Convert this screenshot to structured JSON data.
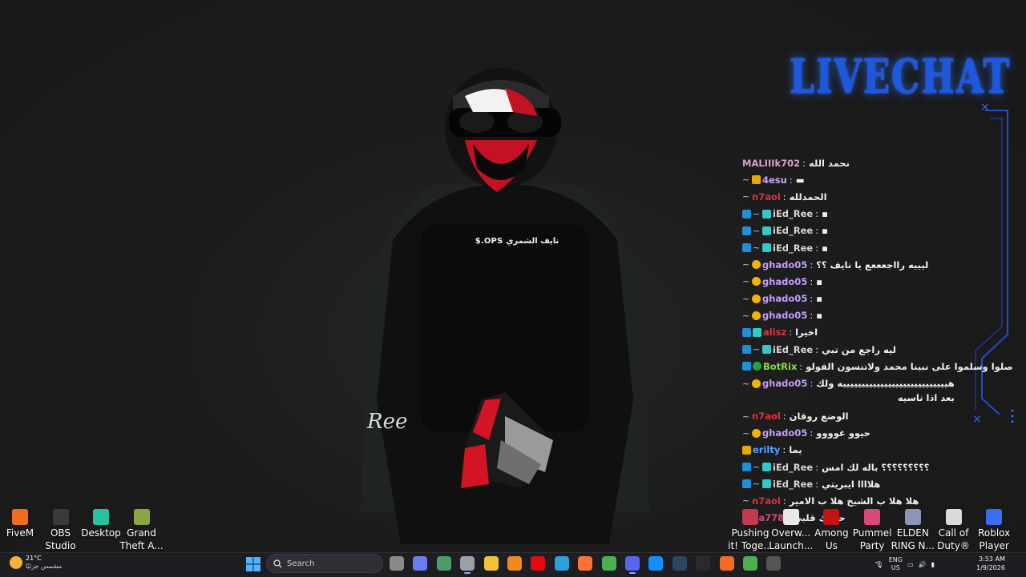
{
  "desktop": {
    "stream_overlay_name": "$.OPS نايف الشمري",
    "signature": "Ree",
    "icons_left": [
      {
        "label": "FiveM",
        "icon": "fivem-icon",
        "color": "#f26b21"
      },
      {
        "label": "OBS Studio",
        "icon": "obs-icon",
        "color": "#3a3a3a"
      },
      {
        "label": "Desktop",
        "icon": "desktop-app-icon",
        "color": "#25c2a0"
      },
      {
        "label": "Grand Theft A...",
        "icon": "gta-icon",
        "color": "#8aa640"
      }
    ],
    "icons_right": [
      {
        "label": "Pushing it! Toge...",
        "icon": "pushing-it-icon",
        "color": "#c23b4b"
      },
      {
        "label": "Overw... Launch...",
        "icon": "overwatch-icon",
        "color": "#e8e8e8"
      },
      {
        "label": "Among Us",
        "icon": "among-us-icon",
        "color": "#c51111"
      },
      {
        "label": "Pummel Party",
        "icon": "pummel-party-icon",
        "color": "#d94a7a"
      },
      {
        "label": "ELDEN RING N...",
        "icon": "elden-ring-icon",
        "color": "#8a95b8"
      },
      {
        "label": "Call of Duty®",
        "icon": "call-of-duty-icon",
        "color": "#dadada"
      },
      {
        "label": "Roblox Player",
        "icon": "roblox-icon",
        "color": "#3a6df0"
      }
    ]
  },
  "livechat": {
    "title": "LIVECHAT",
    "accent": "#1e57e0",
    "messages": [
      {
        "user": "MALIIIk702",
        "color": "#d4a3c8",
        "badges": [],
        "text": "نحمد الله"
      },
      {
        "user": "4esu",
        "color": "#c9a3ff",
        "badges": [
          "tilde",
          "gold"
        ],
        "text": "▬"
      },
      {
        "user": "n7aol",
        "color": "#e0313b",
        "badges": [
          "tilde"
        ],
        "text": "الحمدلله"
      },
      {
        "user": "iEd_Ree",
        "color": "#d6d6d6",
        "badges": [
          "prime",
          "tilde",
          "vip"
        ],
        "text": "▪"
      },
      {
        "user": "iEd_Ree",
        "color": "#d6d6d6",
        "badges": [
          "prime",
          "tilde",
          "vip"
        ],
        "text": "▪"
      },
      {
        "user": "iEd_Ree",
        "color": "#d6d6d6",
        "badges": [
          "prime",
          "tilde",
          "vip"
        ],
        "text": "▪"
      },
      {
        "user": "ghado05",
        "color": "#c69cff",
        "badges": [
          "tilde",
          "sub"
        ],
        "text": "ليييه رااجعععع يا نايف ؟؟"
      },
      {
        "user": "ghado05",
        "color": "#c69cff",
        "badges": [
          "tilde",
          "sub"
        ],
        "text": "▪"
      },
      {
        "user": "ghado05",
        "color": "#c69cff",
        "badges": [
          "tilde",
          "sub"
        ],
        "text": "▪"
      },
      {
        "user": "ghado05",
        "color": "#c69cff",
        "badges": [
          "tilde",
          "sub"
        ],
        "text": "▪"
      },
      {
        "user": "alisz",
        "color": "#e0313b",
        "badges": [
          "prime",
          "vip"
        ],
        "text": "اخيرا"
      },
      {
        "user": "iEd_Ree",
        "color": "#d6d6d6",
        "badges": [
          "prime",
          "tilde",
          "vip"
        ],
        "text": "ليه راجع من تبي"
      },
      {
        "user": "BotRix",
        "color": "#8bdc3c",
        "badges": [
          "prime",
          "mod"
        ],
        "text": "صلوا وسلموا على نبينا محمد ولاتنسون الفولو"
      },
      {
        "user": "ghado05",
        "color": "#c69cff",
        "badges": [
          "tilde",
          "sub"
        ],
        "text": "هييييييييييييييييييييييييييييه ولك",
        "cont": "بعد اذا ناسيه"
      },
      {
        "user": "n7aol",
        "color": "#e0313b",
        "badges": [
          "tilde"
        ],
        "text": "الوضع روقان"
      },
      {
        "user": "ghado05",
        "color": "#c69cff",
        "badges": [
          "tilde",
          "sub"
        ],
        "text": "حيوو غوووو"
      },
      {
        "user": "erilty",
        "color": "#5aa0ff",
        "badges": [
          "gold"
        ],
        "text": "يما"
      },
      {
        "user": "iEd_Ree",
        "color": "#d6d6d6",
        "badges": [
          "prime",
          "tilde",
          "vip"
        ],
        "text": "؟؟؟؟؟؟؟؟؟ باله لك امس"
      },
      {
        "user": "iEd_Ree",
        "color": "#d6d6d6",
        "badges": [
          "prime",
          "tilde",
          "vip"
        ],
        "text": "هلاااا ايبريتي"
      },
      {
        "user": "n7aol",
        "color": "#e0313b",
        "badges": [
          "tilde"
        ],
        "text": "هلا هلا ب الشيخ هلا ب الامير"
      },
      {
        "user": "nina778",
        "color": "#d24b7a",
        "badges": [],
        "text": "حبيبك قلبي"
      }
    ]
  },
  "taskbar": {
    "weather_temp": "21°C",
    "weather_cond": "مشمس جزئيًا",
    "search_placeholder": "Search",
    "lang_top": "ENG",
    "lang_bottom": "US",
    "time": "3:53 AM",
    "date": "1/9/2026",
    "apps": [
      {
        "name": "task-view-icon",
        "color": "#8a8a8a"
      },
      {
        "name": "copilot-icon",
        "color": "#6d7bf0"
      },
      {
        "name": "widgets-icon",
        "color": "#4a9d6a"
      },
      {
        "name": "settings-icon",
        "color": "#9aa0a6"
      },
      {
        "name": "file-explorer-icon",
        "color": "#f3c13a"
      },
      {
        "name": "fl-studio-icon",
        "color": "#f08a1f"
      },
      {
        "name": "netflix-icon",
        "color": "#e50914"
      },
      {
        "name": "telegram-icon",
        "color": "#2aa1da"
      },
      {
        "name": "firefox-icon",
        "color": "#ff7139"
      },
      {
        "name": "chrome-icon",
        "color": "#4caf50"
      },
      {
        "name": "discord-icon",
        "color": "#5865f2"
      },
      {
        "name": "battlenet-icon",
        "color": "#148eff"
      },
      {
        "name": "steam-icon",
        "color": "#2a475e"
      },
      {
        "name": "epic-icon",
        "color": "#2a2a2a"
      },
      {
        "name": "fivem-taskbar-icon",
        "color": "#f26b21"
      },
      {
        "name": "chrome-profile-icon",
        "color": "#4caf50"
      },
      {
        "name": "obs-taskbar-icon",
        "color": "#555555"
      }
    ]
  }
}
